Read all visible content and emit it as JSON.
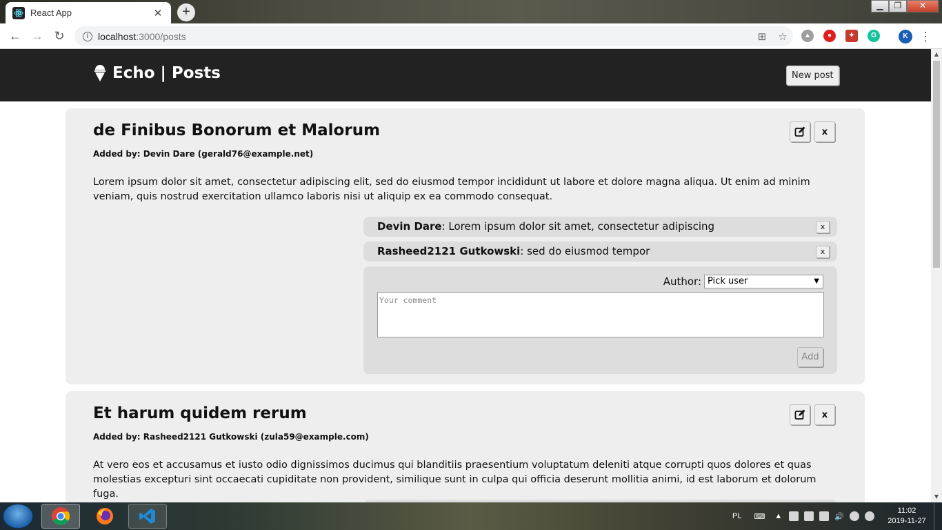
{
  "browser": {
    "tab_title": "React App",
    "tab_close": "✕",
    "new_tab": "+",
    "url_host": "localhost",
    "url_path": ":3000/posts"
  },
  "app": {
    "title": "Echo | Posts",
    "new_post_label": "New post"
  },
  "posts": [
    {
      "title": "de Finibus Bonorum et Malorum",
      "added_by": "Added by: Devin Dare (gerald76@example.net)",
      "body": "Lorem ipsum dolor sit amet, consectetur adipiscing elit, sed do eiusmod tempor incididunt ut labore et dolore magna aliqua. Ut enim ad minim veniam, quis nostrud exercitation ullamco laboris nisi ut aliquip ex ea commodo consequat.",
      "delete_label": "x",
      "comments": [
        {
          "author": "Devin Dare",
          "text": ": Lorem ipsum dolor sit amet, consectetur adipiscing",
          "delete_label": "x"
        },
        {
          "author": "Rasheed2121 Gutkowski",
          "text": ": sed do eiusmod tempor",
          "delete_label": "x"
        }
      ],
      "form": {
        "author_label": "Author:",
        "author_selected": "Pick user",
        "comment_placeholder": "Your comment",
        "add_label": "Add"
      }
    },
    {
      "title": "Et harum quidem rerum",
      "added_by": "Added by: Rasheed2121 Gutkowski (zula59@example.com)",
      "body": "At vero eos et accusamus et iusto odio dignissimos ducimus qui blanditiis praesentium voluptatum deleniti atque corrupti quos dolores et quas molestias excepturi sint occaecati cupiditate non provident, similique sunt in culpa qui officia deserunt mollitia animi, id est laborum et dolorum fuga.",
      "delete_label": "x"
    }
  ],
  "taskbar": {
    "lang": "PL",
    "time": "11:02",
    "date": "2019-11-27"
  },
  "colors": {
    "header_bg": "#222222",
    "post_bg": "#eeeeee",
    "comment_bg": "#dddddd"
  }
}
